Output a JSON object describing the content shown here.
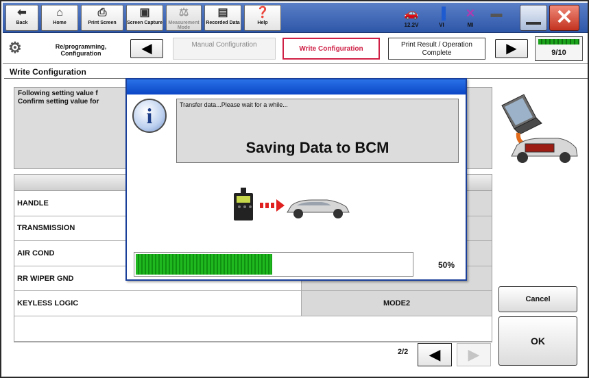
{
  "toolbar": {
    "back": "Back",
    "home": "Home",
    "print_screen": "Print Screen",
    "screen_capture": "Screen Capture",
    "measurement_mode": "Measurement Mode",
    "recorded_data": "Recorded Data",
    "help": "Help",
    "battery_voltage": "12.2V",
    "vi_label": "VI",
    "mi_label": "MI"
  },
  "navigation": {
    "reprogramming": "Re/programming, Configuration",
    "steps": [
      "Manual Configuration",
      "Write Configuration",
      "Print Result / Operation Complete"
    ],
    "active_step": "Write Configuration",
    "step_progress": "9/10"
  },
  "section_title": "Write Configuration",
  "info_text": "Following setting value f\nConfirm setting value for",
  "table": {
    "rows": [
      {
        "name": "HANDLE",
        "value": ""
      },
      {
        "name": "TRANSMISSION",
        "value": ""
      },
      {
        "name": "AIR COND",
        "value": ""
      },
      {
        "name": "RR WIPER GND",
        "value": ""
      },
      {
        "name": "KEYLESS LOGIC",
        "value": "MODE2"
      }
    ]
  },
  "pagination": {
    "page": "2/2"
  },
  "buttons": {
    "cancel": "Cancel",
    "ok": "OK"
  },
  "dialog": {
    "message": "Transfer data...Please wait for a while...",
    "heading": "Saving Data to BCM",
    "progress_percent": 50,
    "progress_label": "50%"
  },
  "colors": {
    "active_step": "#cf1f45",
    "progress": "#1fb81f",
    "title_bar": "#0b46c6"
  }
}
